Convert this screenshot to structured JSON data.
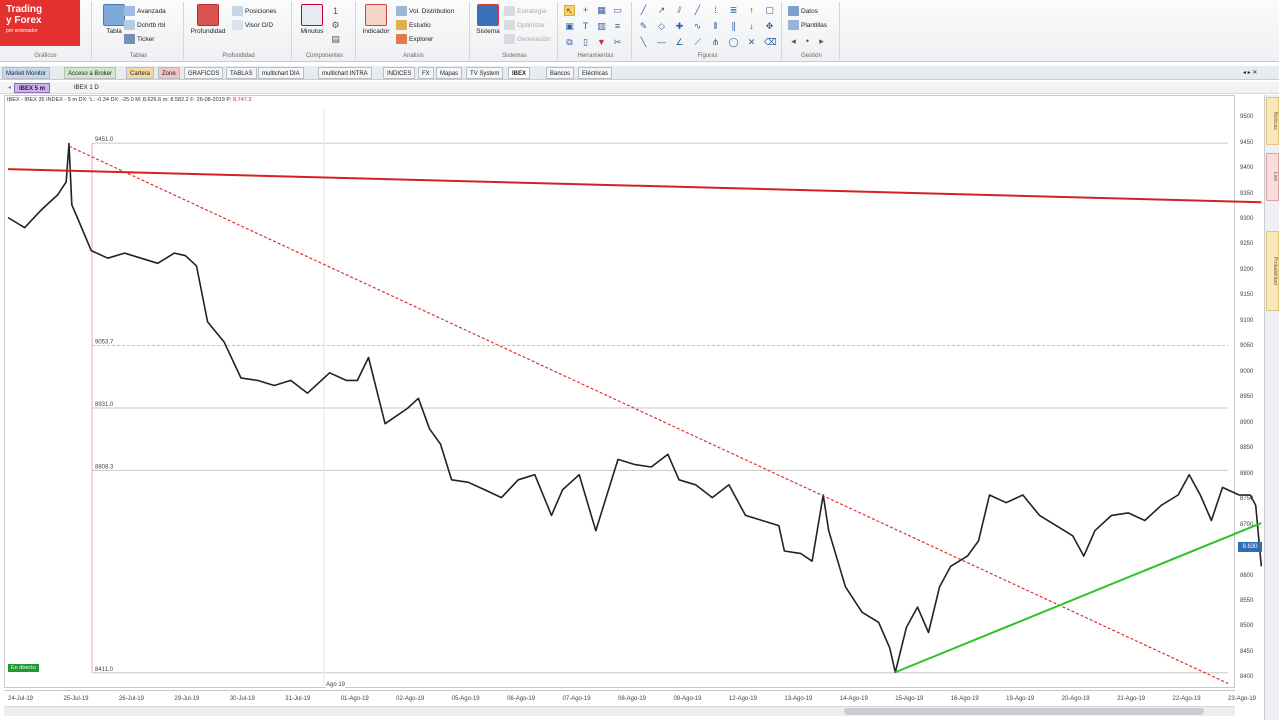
{
  "logo": {
    "line1": "Trading",
    "line2": "y Forex",
    "line3": "por ordenador"
  },
  "ribbon": {
    "groups": [
      {
        "label": "Gráficos"
      },
      {
        "label": "Tablas"
      },
      {
        "label": "Profundidad"
      },
      {
        "label": "Componentes"
      },
      {
        "label": "Análisis"
      },
      {
        "label": "Sistemas"
      },
      {
        "label": "Herramientas"
      },
      {
        "label": "Figuras"
      },
      {
        "label": "Gestión"
      }
    ],
    "buttons": {
      "tabla": "Tabla",
      "avanzada": "Avanzada",
      "dchrtb": "Dchrtb rbl",
      "ticker": "Ticker",
      "profundidad": "Profundidad",
      "posiciones": "Posiciones",
      "visor": "Visor O/D",
      "minutos": "Minutos",
      "indicador": "Indicador",
      "vol_dist": "Vol. Distribution",
      "estudio": "Estudio",
      "explorer": "Explorer",
      "sistema": "Sistema",
      "estrategia": "Estrategia",
      "optimizar": "Optimizar",
      "generacion": "Generación",
      "datos": "Datos",
      "plantillas": "Plantillas"
    }
  },
  "tabs": [
    "Market Monitor",
    "Acceso a Broker",
    "Cartera",
    "Zone",
    "GRAFICOS",
    "TABLAS",
    "multichart DIA",
    "multichart INTRA",
    "INDICES",
    "FX",
    "Mapas",
    "TV System",
    "IBEX",
    "Bancos",
    "Eléctricas"
  ],
  "subtabs": [
    "IBEX 5 m",
    "IBEX 1 D"
  ],
  "chart_info": {
    "text": "IBEX - IBEX 35 INDEX - 5 m  DX: 'L: -0.34  DX: -25.0  M: 8.626.6  m: 8.582.2  F: 26-08-2019  P: ",
    "value": "8.747.3"
  },
  "status_badge": "En directo",
  "apo_label": "Ago 19",
  "price_tag": "8.630",
  "right_panel": [
    "Noticias",
    "Live",
    "Probabilidad"
  ],
  "chart_data": {
    "type": "line",
    "instrument": "IBEX 35 INDEX 5 m",
    "y_ticks": [
      9500,
      9450,
      9400,
      9350,
      9300,
      9250,
      9200,
      9150,
      9100,
      9050,
      9000,
      8950,
      8900,
      8850,
      8800,
      8750,
      8700,
      8650,
      8600,
      8550,
      8500,
      8450,
      8400
    ],
    "ylim": [
      8385,
      9520
    ],
    "x_ticks": [
      "24-Jul-19",
      "25-Jul-19",
      "26-Jul-19",
      "29-Jul-19",
      "30-Jul-19",
      "31-Jul-19",
      "01-Ago-19",
      "02-Ago-19",
      "05-Ago-19",
      "06-Ago-19",
      "07-Ago-19",
      "08-Ago-19",
      "09-Ago-19",
      "12-Ago-19",
      "13-Ago-19",
      "14-Ago-19",
      "15-Ago-19",
      "16-Ago-19",
      "19-Ago-19",
      "20-Ago-19",
      "21-Ago-19",
      "22-Ago-19",
      "23-Ago-19"
    ],
    "fibo_levels": [
      {
        "label": "9451.0",
        "value": 9451.0
      },
      {
        "label": "9053.7",
        "value": 9053.7
      },
      {
        "label": "8931.0",
        "value": 8931.0
      },
      {
        "label": "8808.3",
        "value": 8808.3
      },
      {
        "label": "8411.0",
        "value": 8411.0
      }
    ],
    "trendlines": [
      {
        "name": "resistencia",
        "color": "#d42020",
        "from": [
          0,
          9400
        ],
        "to": [
          22.6,
          9335
        ]
      },
      {
        "name": "bajista",
        "color": "#e03030",
        "dashed": true,
        "from": [
          1.1,
          9445
        ],
        "to": [
          22.0,
          8390
        ]
      },
      {
        "name": "soporte",
        "color": "#2ac42a",
        "from": [
          16.0,
          8412
        ],
        "to": [
          22.6,
          8705
        ]
      }
    ],
    "series": [
      {
        "points": [
          [
            0.0,
            9305
          ],
          [
            0.3,
            9285
          ],
          [
            0.6,
            9320
          ],
          [
            0.9,
            9350
          ],
          [
            1.05,
            9375
          ],
          [
            1.1,
            9450
          ],
          [
            1.15,
            9330
          ],
          [
            1.25,
            9305
          ],
          [
            1.5,
            9240
          ],
          [
            1.8,
            9225
          ],
          [
            2.1,
            9235
          ],
          [
            2.4,
            9225
          ],
          [
            2.7,
            9215
          ],
          [
            3.0,
            9235
          ],
          [
            3.2,
            9230
          ],
          [
            3.4,
            9210
          ],
          [
            3.6,
            9100
          ],
          [
            3.9,
            9060
          ],
          [
            4.2,
            8990
          ],
          [
            4.5,
            8985
          ],
          [
            4.8,
            8975
          ],
          [
            5.1,
            8985
          ],
          [
            5.4,
            8960
          ],
          [
            5.8,
            9000
          ],
          [
            6.1,
            8985
          ],
          [
            6.3,
            8985
          ],
          [
            6.5,
            9030
          ],
          [
            6.8,
            8900
          ],
          [
            7.2,
            8930
          ],
          [
            7.4,
            8950
          ],
          [
            7.6,
            8890
          ],
          [
            7.8,
            8860
          ],
          [
            8.0,
            8790
          ],
          [
            8.3,
            8785
          ],
          [
            8.6,
            8770
          ],
          [
            8.9,
            8755
          ],
          [
            9.2,
            8790
          ],
          [
            9.5,
            8800
          ],
          [
            9.8,
            8720
          ],
          [
            10.0,
            8770
          ],
          [
            10.3,
            8800
          ],
          [
            10.6,
            8690
          ],
          [
            10.8,
            8760
          ],
          [
            11.0,
            8830
          ],
          [
            11.3,
            8820
          ],
          [
            11.6,
            8815
          ],
          [
            11.9,
            8840
          ],
          [
            12.1,
            8790
          ],
          [
            12.4,
            8780
          ],
          [
            12.7,
            8755
          ],
          [
            13.0,
            8780
          ],
          [
            13.3,
            8720
          ],
          [
            13.6,
            8710
          ],
          [
            13.9,
            8700
          ],
          [
            14.0,
            8650
          ],
          [
            14.3,
            8645
          ],
          [
            14.5,
            8630
          ],
          [
            14.7,
            8760
          ],
          [
            14.8,
            8690
          ],
          [
            15.1,
            8580
          ],
          [
            15.4,
            8530
          ],
          [
            15.7,
            8510
          ],
          [
            15.9,
            8460
          ],
          [
            16.0,
            8412
          ],
          [
            16.2,
            8500
          ],
          [
            16.4,
            8540
          ],
          [
            16.6,
            8490
          ],
          [
            16.8,
            8580
          ],
          [
            17.0,
            8620
          ],
          [
            17.3,
            8640
          ],
          [
            17.5,
            8670
          ],
          [
            17.7,
            8760
          ],
          [
            18.0,
            8745
          ],
          [
            18.3,
            8760
          ],
          [
            18.6,
            8720
          ],
          [
            18.9,
            8700
          ],
          [
            19.2,
            8680
          ],
          [
            19.4,
            8640
          ],
          [
            19.6,
            8690
          ],
          [
            19.9,
            8720
          ],
          [
            20.2,
            8725
          ],
          [
            20.5,
            8710
          ],
          [
            20.8,
            8740
          ],
          [
            21.1,
            8760
          ],
          [
            21.3,
            8800
          ],
          [
            21.5,
            8760
          ],
          [
            21.7,
            8710
          ],
          [
            21.9,
            8775
          ],
          [
            22.2,
            8760
          ],
          [
            22.4,
            8760
          ],
          [
            22.5,
            8740
          ],
          [
            22.6,
            8620
          ]
        ]
      }
    ]
  }
}
